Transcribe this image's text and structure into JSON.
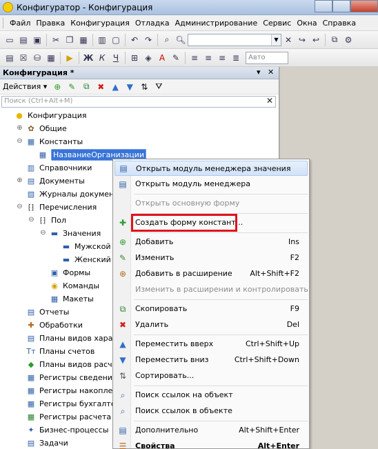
{
  "window": {
    "title": "Конфигуратор - Конфигурация"
  },
  "menu": [
    "Файл",
    "Правка",
    "Конфигурация",
    "Отладка",
    "Администрирование",
    "Сервис",
    "Окна",
    "Справка"
  ],
  "toolbar2": {
    "font_combo": "Авто"
  },
  "panel": {
    "title": "Конфигурация *",
    "actions_label": "Действия",
    "search_placeholder": "Поиск (Ctrl+Alt+M)",
    "tree": [
      {
        "label": "Конфигурация",
        "level": 0,
        "exp": "",
        "icon": "config-icon"
      },
      {
        "label": "Общие",
        "level": 1,
        "exp": "+",
        "icon": "common-icon"
      },
      {
        "label": "Константы",
        "level": 1,
        "exp": "−",
        "icon": "constants-icon"
      },
      {
        "label": "НазваниеОрганизации",
        "level": 2,
        "exp": "",
        "icon": "constant-icon",
        "selected": true
      },
      {
        "label": "Справочники",
        "level": 1,
        "exp": "",
        "icon": "catalogs-icon"
      },
      {
        "label": "Документы",
        "level": 1,
        "exp": "+",
        "icon": "documents-icon"
      },
      {
        "label": "Журналы документов",
        "level": 1,
        "exp": "",
        "icon": "journals-icon"
      },
      {
        "label": "Перечисления",
        "level": 1,
        "exp": "−",
        "icon": "enums-icon"
      },
      {
        "label": "Пол",
        "level": 2,
        "exp": "−",
        "icon": "enum-icon"
      },
      {
        "label": "Значения",
        "level": 3,
        "exp": "−",
        "icon": "values-icon"
      },
      {
        "label": "Мужской",
        "level": 4,
        "exp": "",
        "icon": "value-icon"
      },
      {
        "label": "Женский",
        "level": 4,
        "exp": "",
        "icon": "value-icon"
      },
      {
        "label": "Формы",
        "level": 3,
        "exp": "",
        "icon": "forms-icon"
      },
      {
        "label": "Команды",
        "level": 3,
        "exp": "",
        "icon": "commands-icon"
      },
      {
        "label": "Макеты",
        "level": 3,
        "exp": "",
        "icon": "templates-icon"
      },
      {
        "label": "Отчеты",
        "level": 1,
        "exp": "",
        "icon": "reports-icon"
      },
      {
        "label": "Обработки",
        "level": 1,
        "exp": "",
        "icon": "processing-icon"
      },
      {
        "label": "Планы видов характеристик",
        "level": 1,
        "exp": "",
        "icon": "chart-types-icon"
      },
      {
        "label": "Планы счетов",
        "level": 1,
        "exp": "",
        "icon": "accounts-icon"
      },
      {
        "label": "Планы видов расчета",
        "level": 1,
        "exp": "",
        "icon": "calc-types-icon"
      },
      {
        "label": "Регистры сведений",
        "level": 1,
        "exp": "",
        "icon": "info-registers-icon"
      },
      {
        "label": "Регистры накопления",
        "level": 1,
        "exp": "",
        "icon": "accum-registers-icon"
      },
      {
        "label": "Регистры бухгалтерии",
        "level": 1,
        "exp": "",
        "icon": "acc-registers-icon"
      },
      {
        "label": "Регистры расчета",
        "level": 1,
        "exp": "",
        "icon": "calc-registers-icon"
      },
      {
        "label": "Бизнес-процессы",
        "level": 1,
        "exp": "",
        "icon": "bp-icon"
      },
      {
        "label": "Задачи",
        "level": 1,
        "exp": "",
        "icon": "tasks-icon"
      }
    ]
  },
  "context_menu": [
    {
      "text": "Открыть модуль менеджера значения",
      "key": "",
      "icon": "module-icon",
      "state": "hover"
    },
    {
      "text": "Открыть модуль менеджера",
      "key": "",
      "icon": "module-icon",
      "state": ""
    },
    {
      "sep": true
    },
    {
      "text": "Открыть основную форму",
      "key": "",
      "icon": "",
      "state": "disabled"
    },
    {
      "sep": true
    },
    {
      "text": "Создать форму констант...",
      "key": "",
      "icon": "new-form-icon",
      "state": "highlighted"
    },
    {
      "sep": true
    },
    {
      "text": "Добавить",
      "key": "Ins",
      "icon": "add-icon",
      "state": ""
    },
    {
      "text": "Изменить",
      "key": "F2",
      "icon": "edit-icon",
      "state": ""
    },
    {
      "text": "Добавить в расширение",
      "key": "Alt+Shift+F2",
      "icon": "add-ext-icon",
      "state": ""
    },
    {
      "text": "Изменить в расширении и контролировать",
      "key": "",
      "icon": "",
      "state": "disabled"
    },
    {
      "sep": true
    },
    {
      "text": "Скопировать",
      "key": "F9",
      "icon": "copy-icon",
      "state": ""
    },
    {
      "text": "Удалить",
      "key": "Del",
      "icon": "delete-icon",
      "state": ""
    },
    {
      "sep": true
    },
    {
      "text": "Переместить вверх",
      "key": "Ctrl+Shift+Up",
      "icon": "move-up-icon",
      "state": ""
    },
    {
      "text": "Переместить вниз",
      "key": "Ctrl+Shift+Down",
      "icon": "move-down-icon",
      "state": ""
    },
    {
      "text": "Сортировать...",
      "key": "",
      "icon": "sort-icon",
      "state": ""
    },
    {
      "sep": true
    },
    {
      "text": "Поиск ссылок на объект",
      "key": "",
      "icon": "find-refs-icon",
      "state": ""
    },
    {
      "text": "Поиск ссылок в объекте",
      "key": "",
      "icon": "find-in-icon",
      "state": ""
    },
    {
      "sep": true
    },
    {
      "text": "Дополнительно",
      "key": "Alt+Shift+Enter",
      "icon": "extra-icon",
      "state": ""
    },
    {
      "text": "Свойства",
      "key": "Alt+Enter",
      "icon": "properties-icon",
      "state": "bold"
    }
  ],
  "colors": {
    "selection": "#3874d8",
    "highlight_box": "#e0121c"
  }
}
